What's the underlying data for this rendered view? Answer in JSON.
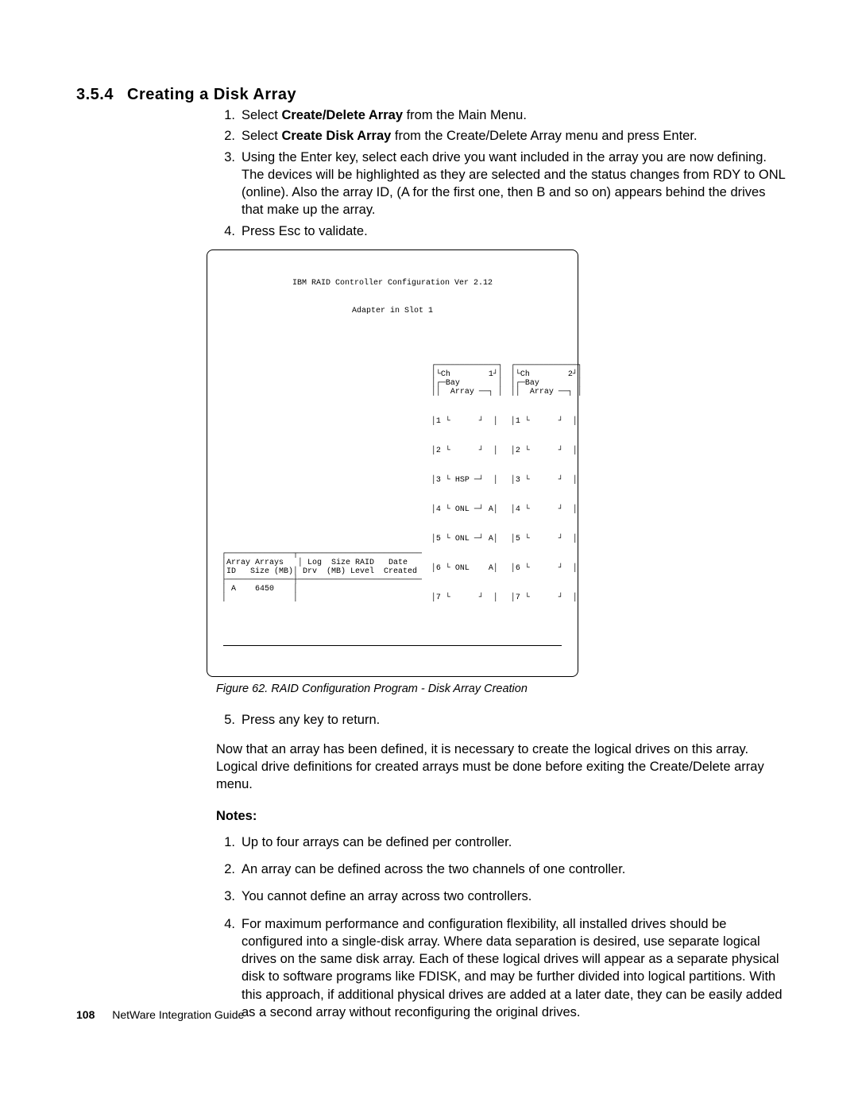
{
  "section_number": "3.5.4",
  "section_title": "Creating a Disk Array",
  "steps": {
    "s1": {
      "mk": "1.",
      "prefix": "Select ",
      "bold": "Create/Delete Array",
      "suffix": " from the Main Menu."
    },
    "s2": {
      "mk": "2.",
      "prefix": "Select ",
      "bold": "Create Disk Array",
      "suffix": " from the Create/Delete Array menu and press Enter."
    },
    "s3": {
      "mk": "3.",
      "text": "Using the Enter key, select each drive you want included in the array you are now defining. The devices will be highlighted as they are selected and the status changes from RDY to ONL (online).  Also the array ID, (A for the first one, then B and so on) appears behind the drives that make up the array."
    },
    "s4": {
      "mk": "4.",
      "text": "Press Esc to validate."
    }
  },
  "figure": {
    "title": "IBM RAID Controller Configuration Ver 2.12",
    "subtitle": "Adapter in Slot 1",
    "array_header1": "Array Arrays   │ Log  Size RAID   Date",
    "array_header2": "ID   Size (MB)│ Drv  (MB) Level  Created",
    "array_row": " A    6450    │",
    "ch1": {
      "head": "┌─────────────┐\n│└Ch        1┘│\n│┌─Bay        │\n││  Array ──┐ │",
      "rows": [
        "│1 └      ┘  │",
        "│2 └      ┘  │",
        "│3 └ HSP ─┘  │",
        "│4 └ ONL ─┘ A│",
        "│5 └ ONL ─┘ A│",
        "│6 └ ONL    A│",
        "│7 └      ┘  │"
      ]
    },
    "ch2": {
      "head": "┌─────────────┐\n│└Ch        2┘│\n│┌─Bay        │\n││  Array ──┐ │",
      "rows": [
        "│1 └      ┘  │",
        "│2 └      ┘  │",
        "│3 └      ┘  │",
        "│4 └      ┘  │",
        "│5 └      ┘  │",
        "│6 └      ┘  │",
        "│7 └      ┘  │"
      ]
    }
  },
  "caption": "Figure  62.  RAID Configuration Program - Disk Array Creation",
  "step5": {
    "mk": " 5.",
    "text": "Press any key to return."
  },
  "para_after": "Now that an array has been defined, it is necessary to create the logical drives on this array.  Logical drive definitions for created arrays must be done before exiting the Create/Delete array menu.",
  "notes_heading": "Notes:",
  "notes": {
    "n1": {
      "mk": "1.",
      "text": "Up to four arrays can be defined per controller."
    },
    "n2": {
      "mk": "2.",
      "text": "An array can be defined across the two channels of one controller."
    },
    "n3": {
      "mk": "3.",
      "text": "You cannot define an array across two controllers."
    },
    "n4": {
      "mk": "4.",
      "text": "For maximum performance and configuration flexibility, all installed drives should be configured into a single-disk array. Where data separation is desired, use separate logical drives on the same disk array. Each of these logical drives will appear as a separate physical disk to software programs like FDISK, and may be further divided into logical partitions. With this approach, if additional physical drives are added at a later date, they can be easily added as a second array without reconfiguring the original drives."
    }
  },
  "footer": {
    "page": "108",
    "book": "NetWare Integration Guide"
  }
}
